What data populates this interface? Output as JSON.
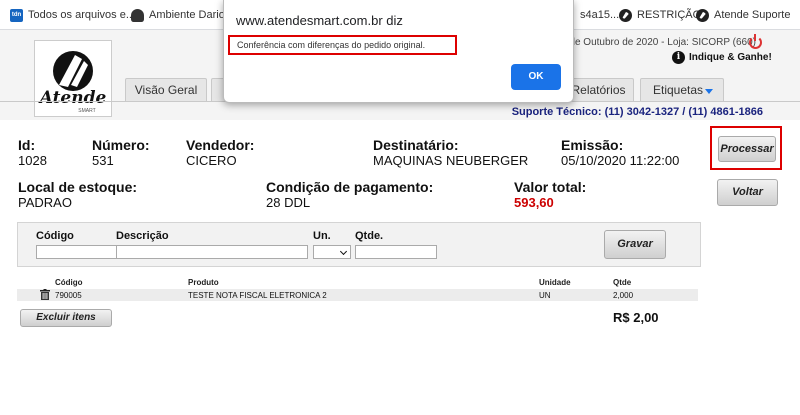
{
  "bookmarks": [
    {
      "label": "Todos os arquivos e...",
      "icon": "tdn-icon"
    },
    {
      "label": "Ambiente Dario",
      "icon": "user-icon"
    },
    {
      "label": "s4a15...",
      "icon": "none"
    },
    {
      "label": "RESTRIÇÃO",
      "icon": "atende-icon"
    },
    {
      "label": "Atende Suporte",
      "icon": "atende-icon"
    }
  ],
  "header": {
    "info": "de Outubro de 2020 - Loja: SICORP (660)",
    "indique": "Indique & Ganhe!",
    "logo_text": "Atende",
    "logo_subtext": "SMART"
  },
  "tabs": [
    "Visão Geral",
    "Relatórios",
    "Etiquetas"
  ],
  "support": "Suporte Técnico: (11) 3042-1327 / (11) 4861-1866",
  "order": {
    "id_label": "Id:",
    "id": "1028",
    "numero_label": "Número:",
    "numero": "531",
    "vendedor_label": "Vendedor:",
    "vendedor": "CICERO",
    "destinatario_label": "Destinatário:",
    "destinatario": "MAQUINAS NEUBERGER",
    "emissao_label": "Emissão:",
    "emissao": "05/10/2020 11:22:00",
    "local_label": "Local de estoque:",
    "local": "PADRAO",
    "condicao_label": "Condição de pagamento:",
    "condicao": "28 DDL",
    "valor_label": "Valor total:",
    "valor": "593,60"
  },
  "buttons": {
    "processar": "Processar",
    "voltar": "Voltar",
    "gravar": "Gravar",
    "excluir": "Excluir itens",
    "ok": "OK"
  },
  "form": {
    "codigo_label": "Código",
    "descricao_label": "Descrição",
    "un_label": "Un.",
    "qtde_label": "Qtde."
  },
  "table": {
    "headers": [
      "Código",
      "Produto",
      "Unidade",
      "Qtde"
    ],
    "rows": [
      {
        "codigo": "790005",
        "produto": "TESTE NOTA FISCAL ELETRONICA 2",
        "unidade": "UN",
        "qtde": "2,000"
      }
    ],
    "total": "R$ 2,00"
  },
  "dialog": {
    "title": "www.atendesmart.com.br diz",
    "message": "Conferência com diferenças do pedido original."
  },
  "colors": {
    "accent": "#1a73e8",
    "alert_border": "#dd0000",
    "value_red": "#cc0000",
    "support_blue": "#1a237e"
  }
}
